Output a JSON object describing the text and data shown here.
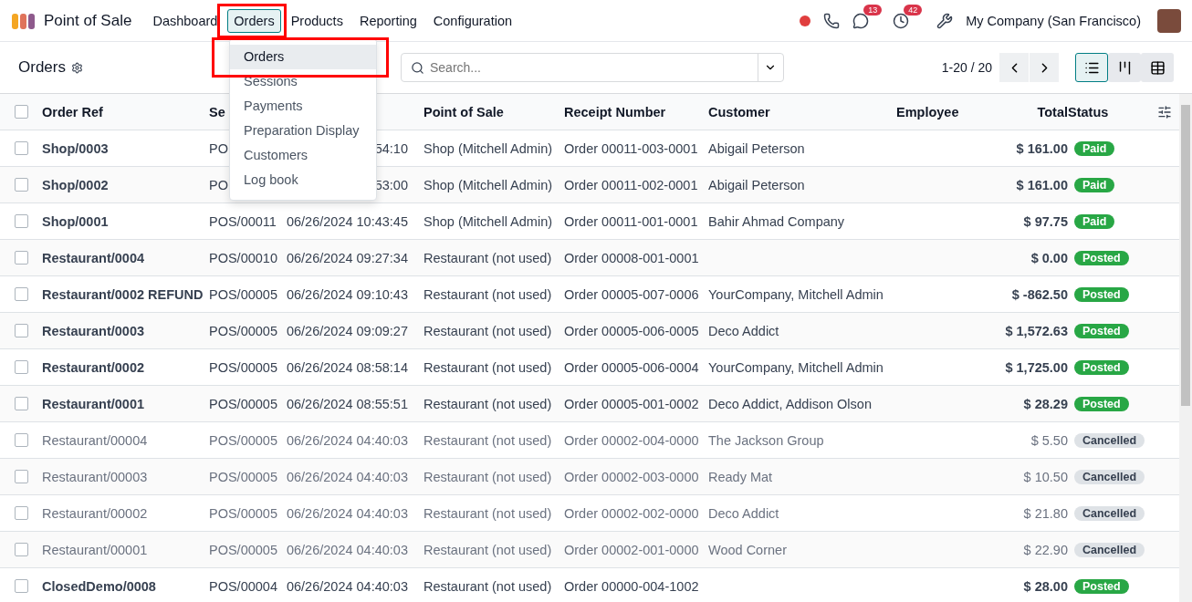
{
  "app": {
    "title": "Point of Sale"
  },
  "menu": [
    {
      "label": "Dashboard",
      "selected": false
    },
    {
      "label": "Orders",
      "selected": true
    },
    {
      "label": "Products",
      "selected": false
    },
    {
      "label": "Reporting",
      "selected": false
    },
    {
      "label": "Configuration",
      "selected": false
    }
  ],
  "systray": {
    "chat_count": "13",
    "activity_count": "42",
    "company": "My Company (San Francisco)"
  },
  "dropdown": [
    {
      "label": "Orders",
      "selected": true
    },
    {
      "label": "Sessions",
      "selected": false
    },
    {
      "label": "Payments",
      "selected": false
    },
    {
      "label": "Preparation Display",
      "selected": false
    },
    {
      "label": "Customers",
      "selected": false
    },
    {
      "label": "Log book",
      "selected": false
    }
  ],
  "breadcrumb": "Orders",
  "search": {
    "placeholder": "Search..."
  },
  "pager": "1-20 / 20",
  "views": [
    {
      "kind": "list",
      "selected": true
    },
    {
      "kind": "kanban",
      "selected": false
    },
    {
      "kind": "pivot",
      "selected": false
    }
  ],
  "table": {
    "all_checked": false,
    "columns": [
      "Order Ref",
      "Se",
      "Point of Sale",
      "Receipt Number",
      "Customer",
      "Employee",
      "Total",
      "Status"
    ],
    "rows": [
      {
        "ref": "Shop/0003",
        "session": "PO",
        "date": "54:10",
        "pos": "Shop (Mitchell Admin)",
        "receipt": "Order 00011-003-0001",
        "customer": "Abigail Peterson",
        "total": "$ 161.00",
        "status": "Paid",
        "kind": "success",
        "muted": false
      },
      {
        "ref": "Shop/0002",
        "session": "PO",
        "date": "53:00",
        "pos": "Shop (Mitchell Admin)",
        "receipt": "Order 00011-002-0001",
        "customer": "Abigail Peterson",
        "total": "$ 161.00",
        "status": "Paid",
        "kind": "success",
        "muted": false
      },
      {
        "ref": "Shop/0001",
        "session": "POS/00011",
        "date": "06/26/2024 10:43:45",
        "pos": "Shop (Mitchell Admin)",
        "receipt": "Order 00011-001-0001",
        "customer": "Bahir Ahmad Company",
        "total": "$ 97.75",
        "status": "Paid",
        "kind": "success",
        "muted": false
      },
      {
        "ref": "Restaurant/0004",
        "session": "POS/00010",
        "date": "06/26/2024 09:27:34",
        "pos": "Restaurant (not used)",
        "receipt": "Order 00008-001-0001",
        "total": "$ 0.00",
        "status": "Posted",
        "kind": "success",
        "muted": false
      },
      {
        "ref": "Restaurant/0002 REFUND",
        "session": "POS/00005",
        "date": "06/26/2024 09:10:43",
        "pos": "Restaurant (not used)",
        "receipt": "Order 00005-007-0006",
        "customer": "YourCompany, Mitchell Admin",
        "total": "$ -862.50",
        "status": "Posted",
        "kind": "success",
        "muted": false
      },
      {
        "ref": "Restaurant/0003",
        "session": "POS/00005",
        "date": "06/26/2024 09:09:27",
        "pos": "Restaurant (not used)",
        "receipt": "Order 00005-006-0005",
        "customer": "Deco Addict",
        "total": "$ 1,572.63",
        "status": "Posted",
        "kind": "success",
        "muted": false
      },
      {
        "ref": "Restaurant/0002",
        "session": "POS/00005",
        "date": "06/26/2024 08:58:14",
        "pos": "Restaurant (not used)",
        "receipt": "Order 00005-006-0004",
        "customer": "YourCompany, Mitchell Admin",
        "total": "$ 1,725.00",
        "status": "Posted",
        "kind": "success",
        "muted": false
      },
      {
        "ref": "Restaurant/0001",
        "session": "POS/00005",
        "date": "06/26/2024 08:55:51",
        "pos": "Restaurant (not used)",
        "receipt": "Order 00005-001-0002",
        "customer": "Deco Addict, Addison Olson",
        "total": "$ 28.29",
        "status": "Posted",
        "kind": "success",
        "muted": false
      },
      {
        "ref": "Restaurant/00004",
        "session": "POS/00005",
        "date": "06/26/2024 04:40:03",
        "pos": "Restaurant (not used)",
        "receipt": "Order 00002-004-0000",
        "customer": "The Jackson Group",
        "total": "$ 5.50",
        "status": "Cancelled",
        "kind": "neutral",
        "muted": true
      },
      {
        "ref": "Restaurant/00003",
        "session": "POS/00005",
        "date": "06/26/2024 04:40:03",
        "pos": "Restaurant (not used)",
        "receipt": "Order 00002-003-0000",
        "customer": "Ready Mat",
        "total": "$ 10.50",
        "status": "Cancelled",
        "kind": "neutral",
        "muted": true
      },
      {
        "ref": "Restaurant/00002",
        "session": "POS/00005",
        "date": "06/26/2024 04:40:03",
        "pos": "Restaurant (not used)",
        "receipt": "Order 00002-002-0000",
        "customer": "Deco Addict",
        "total": "$ 21.80",
        "status": "Cancelled",
        "kind": "neutral",
        "muted": true
      },
      {
        "ref": "Restaurant/00001",
        "session": "POS/00005",
        "date": "06/26/2024 04:40:03",
        "pos": "Restaurant (not used)",
        "receipt": "Order 00002-001-0000",
        "customer": "Wood Corner",
        "total": "$ 22.90",
        "status": "Cancelled",
        "kind": "neutral",
        "muted": true
      },
      {
        "ref": "ClosedDemo/0008",
        "session": "POS/00004",
        "date": "06/26/2024 04:40:03",
        "pos": "Restaurant (not used)",
        "receipt": "Order 00000-004-1002",
        "total": "$ 28.00",
        "status": "Posted",
        "kind": "success",
        "muted": false
      }
    ]
  }
}
